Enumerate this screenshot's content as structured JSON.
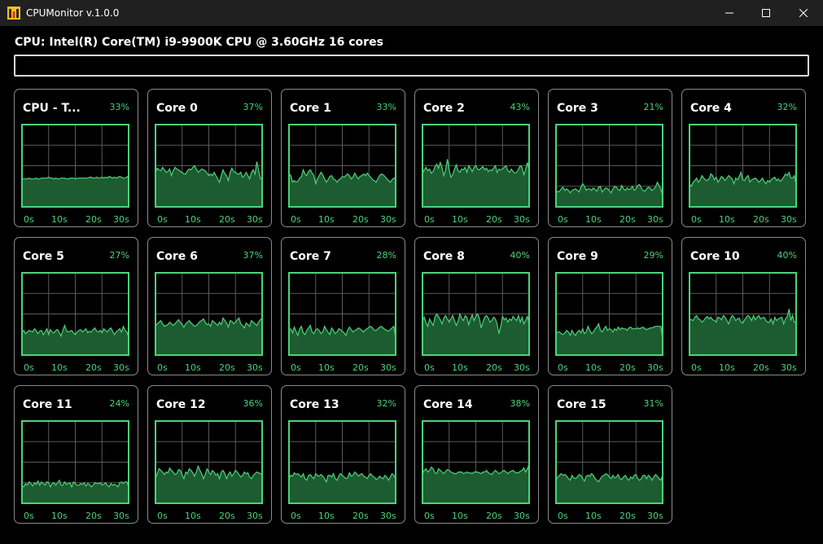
{
  "window": {
    "title": "CPUMonitor v.1.0.0",
    "controls": {
      "minimize": "minimize-icon",
      "maximize": "maximize-icon",
      "close": "close-icon"
    }
  },
  "header": {
    "cpu_label": "CPU: Intel(R) Core(TM) i9-9900K CPU @ 3.60GHz 16 cores",
    "progress_value": 0
  },
  "colors": {
    "accent": "#4cd37a",
    "fill": "#1d5c30",
    "grid": "#5a5a5a",
    "card_border": "#8a8a8a"
  },
  "axis_ticks": [
    "0s",
    "10s",
    "20s",
    "30s"
  ],
  "cards": [
    {
      "name": "CPU - T...",
      "percent": "33%",
      "history": [
        34,
        34,
        34,
        34,
        35,
        34,
        34,
        34,
        35,
        34,
        34,
        35,
        35,
        35,
        35,
        36,
        35,
        35,
        34,
        35,
        34,
        34,
        35,
        35,
        35,
        34,
        34,
        35,
        35,
        35,
        34,
        35,
        35,
        35,
        35,
        35,
        35,
        35,
        36,
        36,
        35,
        35,
        36,
        35,
        35,
        36,
        35,
        36,
        35,
        37,
        36,
        35,
        36,
        35,
        36,
        37,
        36,
        35,
        35,
        36,
        38
      ]
    },
    {
      "name": "Core 0",
      "percent": "37%",
      "history": [
        42,
        47,
        45,
        44,
        48,
        45,
        42,
        43,
        46,
        38,
        44,
        48,
        46,
        45,
        43,
        42,
        40,
        40,
        44,
        46,
        45,
        48,
        50,
        46,
        42,
        44,
        46,
        45,
        44,
        41,
        38,
        40,
        38,
        42,
        38,
        34,
        30,
        38,
        45,
        40,
        38,
        32,
        42,
        47,
        43,
        42,
        40,
        40,
        42,
        36,
        38,
        42,
        38,
        34,
        42,
        45,
        40,
        55,
        45,
        35,
        33
      ]
    },
    {
      "name": "Core 1",
      "percent": "33%",
      "history": [
        40,
        38,
        30,
        32,
        30,
        31,
        35,
        37,
        45,
        40,
        38,
        43,
        45,
        41,
        38,
        28,
        34,
        38,
        42,
        39,
        34,
        30,
        33,
        37,
        38,
        34,
        33,
        30,
        33,
        34,
        37,
        36,
        38,
        40,
        38,
        34,
        36,
        41,
        37,
        34,
        37,
        38,
        40,
        38,
        41,
        38,
        36,
        33,
        32,
        30,
        34,
        38,
        40,
        39,
        37,
        34,
        32,
        30,
        33,
        35,
        34
      ]
    },
    {
      "name": "Core 2",
      "percent": "43%",
      "history": [
        40,
        45,
        48,
        44,
        46,
        41,
        43,
        49,
        52,
        47,
        54,
        48,
        38,
        45,
        58,
        45,
        36,
        39,
        46,
        51,
        44,
        42,
        46,
        45,
        48,
        42,
        50,
        47,
        43,
        48,
        50,
        46,
        45,
        47,
        49,
        45,
        47,
        43,
        45,
        44,
        47,
        50,
        42,
        46,
        45,
        46,
        48,
        50,
        44,
        42,
        46,
        43,
        41,
        42,
        46,
        50,
        48,
        39,
        45,
        54,
        45
      ]
    },
    {
      "name": "Core 3",
      "percent": "21%",
      "history": [
        20,
        18,
        19,
        22,
        24,
        20,
        22,
        20,
        17,
        20,
        21,
        22,
        20,
        18,
        24,
        28,
        25,
        20,
        22,
        22,
        20,
        23,
        21,
        19,
        24,
        25,
        18,
        21,
        23,
        22,
        20,
        17,
        22,
        25,
        24,
        21,
        20,
        26,
        22,
        20,
        23,
        21,
        22,
        25,
        20,
        22,
        26,
        27,
        23,
        20,
        19,
        22,
        24,
        23,
        20,
        22,
        24,
        30,
        26,
        22,
        14
      ]
    },
    {
      "name": "Core 4",
      "percent": "32%",
      "history": [
        28,
        25,
        30,
        32,
        35,
        30,
        33,
        38,
        35,
        33,
        32,
        34,
        40,
        38,
        33,
        36,
        30,
        33,
        37,
        35,
        32,
        35,
        38,
        36,
        34,
        28,
        35,
        33,
        37,
        42,
        33,
        32,
        36,
        38,
        30,
        33,
        34,
        35,
        33,
        30,
        32,
        35,
        31,
        28,
        32,
        30,
        33,
        35,
        36,
        32,
        34,
        31,
        33,
        36,
        40,
        38,
        42,
        35,
        35,
        38,
        27
      ]
    },
    {
      "name": "Core 5",
      "percent": "27%",
      "history": [
        28,
        30,
        26,
        28,
        30,
        29,
        28,
        32,
        30,
        26,
        29,
        30,
        25,
        28,
        32,
        25,
        31,
        28,
        27,
        30,
        31,
        27,
        23,
        30,
        36,
        30,
        28,
        29,
        30,
        27,
        25,
        28,
        30,
        31,
        28,
        30,
        32,
        27,
        29,
        28,
        31,
        33,
        29,
        28,
        30,
        27,
        32,
        30,
        28,
        31,
        33,
        29,
        25,
        28,
        30,
        32,
        28,
        35,
        30,
        28,
        22
      ]
    },
    {
      "name": "Core 6",
      "percent": "37%",
      "history": [
        35,
        38,
        40,
        42,
        38,
        35,
        36,
        37,
        40,
        38,
        36,
        38,
        41,
        43,
        40,
        37,
        34,
        38,
        40,
        42,
        39,
        37,
        35,
        36,
        38,
        41,
        42,
        44,
        40,
        37,
        38,
        35,
        42,
        40,
        38,
        36,
        40,
        37,
        45,
        42,
        39,
        34,
        42,
        41,
        38,
        40,
        43,
        45,
        38,
        36,
        33,
        39,
        37,
        35,
        42,
        40,
        38,
        36,
        40,
        43,
        45
      ]
    },
    {
      "name": "Core 7",
      "percent": "28%",
      "history": [
        30,
        32,
        27,
        34,
        29,
        24,
        32,
        35,
        27,
        25,
        30,
        33,
        36,
        28,
        26,
        31,
        32,
        30,
        26,
        28,
        35,
        31,
        28,
        25,
        33,
        30,
        26,
        28,
        32,
        31,
        29,
        27,
        24,
        30,
        34,
        31,
        28,
        30,
        31,
        33,
        32,
        30,
        28,
        31,
        32,
        34,
        35,
        33,
        30,
        30,
        32,
        34,
        35,
        33,
        31,
        30,
        29,
        31,
        33,
        35,
        20
      ]
    },
    {
      "name": "Core 8",
      "percent": "40%",
      "history": [
        42,
        46,
        39,
        35,
        44,
        40,
        36,
        46,
        50,
        47,
        43,
        38,
        45,
        48,
        44,
        40,
        44,
        48,
        42,
        36,
        41,
        50,
        45,
        42,
        48,
        46,
        37,
        44,
        49,
        42,
        47,
        50,
        45,
        33,
        40,
        46,
        48,
        45,
        40,
        42,
        46,
        44,
        38,
        26,
        35,
        47,
        43,
        45,
        40,
        44,
        42,
        47,
        44,
        42,
        48,
        40,
        46,
        38,
        42,
        47,
        38
      ]
    },
    {
      "name": "Core 9",
      "percent": "29%",
      "history": [
        26,
        28,
        28,
        26,
        25,
        27,
        30,
        28,
        24,
        30,
        26,
        24,
        28,
        30,
        27,
        32,
        26,
        28,
        35,
        30,
        26,
        28,
        32,
        34,
        38,
        30,
        28,
        32,
        35,
        30,
        32,
        31,
        28,
        32,
        30,
        34,
        31,
        33,
        32,
        32,
        30,
        33,
        34,
        32,
        32,
        32,
        33,
        32,
        33,
        34,
        32,
        31,
        32,
        33,
        33,
        34,
        35,
        35,
        35,
        35,
        20
      ]
    },
    {
      "name": "Core 10",
      "percent": "40%",
      "history": [
        44,
        43,
        42,
        46,
        48,
        44,
        43,
        40,
        42,
        45,
        47,
        44,
        46,
        43,
        42,
        40,
        46,
        45,
        43,
        48,
        46,
        42,
        38,
        44,
        48,
        46,
        42,
        44,
        45,
        40,
        39,
        43,
        46,
        48,
        46,
        42,
        48,
        43,
        46,
        48,
        44,
        45,
        46,
        42,
        40,
        40,
        44,
        38,
        46,
        42,
        44,
        45,
        46,
        38,
        44,
        47,
        56,
        42,
        48,
        40,
        40
      ]
    },
    {
      "name": "Core 11",
      "percent": "24%",
      "history": [
        21,
        20,
        24,
        22,
        26,
        24,
        21,
        25,
        23,
        27,
        22,
        26,
        24,
        22,
        26,
        25,
        20,
        24,
        25,
        22,
        25,
        28,
        22,
        22,
        26,
        23,
        24,
        25,
        20,
        26,
        24,
        22,
        22,
        24,
        23,
        25,
        21,
        24,
        23,
        20,
        22,
        25,
        24,
        24,
        25,
        22,
        23,
        25,
        22,
        20,
        24,
        22,
        23,
        22,
        20,
        25,
        26,
        24,
        26,
        26,
        20
      ]
    },
    {
      "name": "Core 12",
      "percent": "36%",
      "history": [
        30,
        36,
        42,
        40,
        38,
        35,
        38,
        37,
        43,
        40,
        38,
        35,
        36,
        41,
        40,
        34,
        30,
        38,
        36,
        42,
        40,
        37,
        33,
        38,
        45,
        40,
        36,
        30,
        35,
        42,
        38,
        35,
        40,
        38,
        34,
        36,
        30,
        38,
        40,
        36,
        30,
        35,
        38,
        33,
        36,
        40,
        38,
        35,
        32,
        34,
        38,
        36,
        37,
        32,
        30,
        34,
        36,
        38,
        37,
        36,
        36
      ]
    },
    {
      "name": "Core 13",
      "percent": "32%",
      "history": [
        30,
        34,
        33,
        37,
        35,
        36,
        34,
        32,
        36,
        30,
        28,
        34,
        35,
        32,
        30,
        36,
        34,
        33,
        35,
        33,
        30,
        26,
        34,
        34,
        32,
        36,
        30,
        28,
        33,
        36,
        34,
        32,
        30,
        31,
        37,
        33,
        34,
        38,
        36,
        33,
        35,
        36,
        33,
        32,
        30,
        34,
        36,
        33,
        32,
        29,
        30,
        33,
        31,
        30,
        34,
        32,
        28,
        32,
        36,
        34,
        30
      ]
    },
    {
      "name": "Core 14",
      "percent": "38%",
      "history": [
        36,
        40,
        42,
        38,
        40,
        44,
        42,
        37,
        36,
        42,
        40,
        38,
        36,
        39,
        41,
        40,
        38,
        37,
        36,
        36,
        38,
        38,
        38,
        36,
        37,
        38,
        37,
        37,
        36,
        38,
        38,
        38,
        37,
        36,
        38,
        38,
        40,
        37,
        36,
        35,
        38,
        40,
        38,
        36,
        37,
        39,
        40,
        38,
        36,
        38,
        39,
        40,
        38,
        37,
        37,
        39,
        40,
        43,
        38,
        42,
        47
      ]
    },
    {
      "name": "Core 15",
      "percent": "31%",
      "history": [
        28,
        32,
        34,
        36,
        34,
        35,
        33,
        30,
        28,
        34,
        31,
        30,
        32,
        35,
        34,
        30,
        27,
        33,
        34,
        33,
        36,
        34,
        30,
        28,
        26,
        30,
        33,
        34,
        36,
        35,
        32,
        30,
        34,
        31,
        32,
        35,
        30,
        29,
        32,
        34,
        30,
        28,
        32,
        30,
        34,
        35,
        30,
        28,
        30,
        34,
        34,
        30,
        34,
        32,
        28,
        32,
        35,
        33,
        30,
        28,
        34
      ]
    }
  ]
}
